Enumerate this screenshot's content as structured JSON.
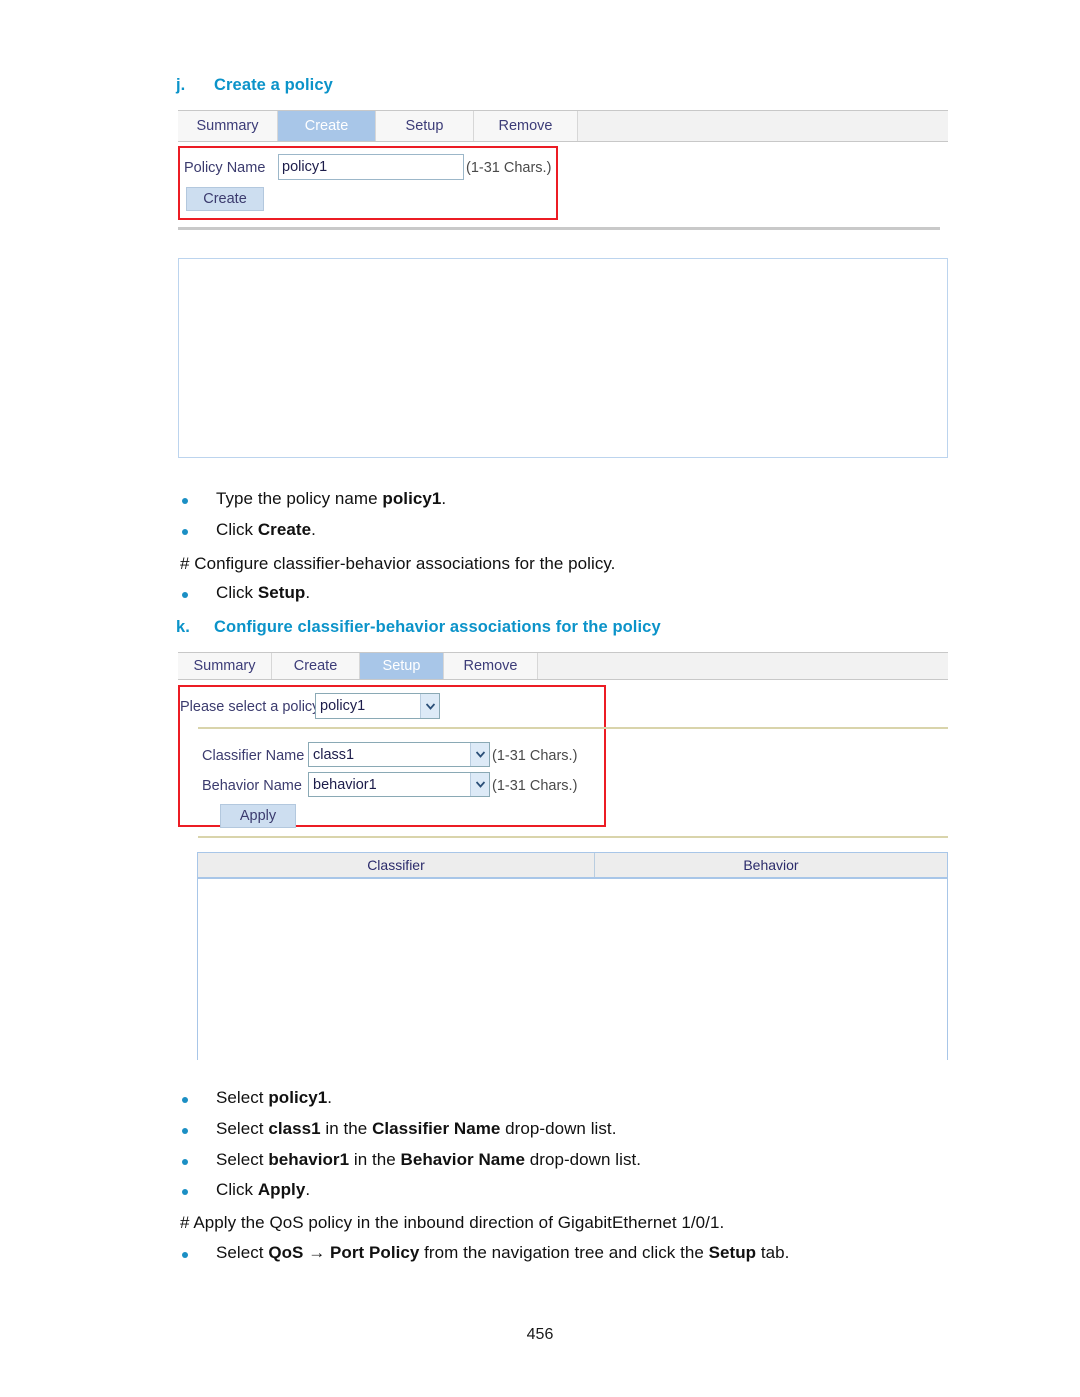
{
  "page": {
    "number": "456"
  },
  "section_j": {
    "letter": "j.",
    "title": "Create a policy",
    "tabs": [
      {
        "label": "Summary",
        "active": false
      },
      {
        "label": "Create",
        "active": true
      },
      {
        "label": "Setup",
        "active": false
      },
      {
        "label": "Remove",
        "active": false
      }
    ],
    "form": {
      "policy_name_label": "Policy Name",
      "policy_name_value": "policy1",
      "policy_name_hint": "(1-31 Chars.)",
      "create_button": "Create"
    }
  },
  "steps_middle": [
    {
      "type": "bullet",
      "text": "Type the policy name ",
      "bold": "policy1",
      "tail": "."
    },
    {
      "type": "bullet",
      "text": "Click ",
      "bold": "Create",
      "tail": "."
    },
    {
      "type": "para",
      "text": "# Configure classifier-behavior associations for the policy."
    },
    {
      "type": "bullet",
      "text": "Click ",
      "bold": "Setup",
      "tail": "."
    }
  ],
  "section_k": {
    "letter": "k.",
    "title": "Configure classifier-behavior associations for the policy",
    "tabs": [
      {
        "label": "Summary",
        "active": false
      },
      {
        "label": "Create",
        "active": false
      },
      {
        "label": "Setup",
        "active": true
      },
      {
        "label": "Remove",
        "active": false
      }
    ],
    "form": {
      "select_policy_label": "Please select a policy",
      "select_policy_value": "policy1",
      "classifier_label": "Classifier Name",
      "classifier_value": "class1",
      "classifier_hint": "(1-31 Chars.)",
      "behavior_label": "Behavior Name",
      "behavior_value": "behavior1",
      "behavior_hint": "(1-31 Chars.)",
      "apply_button": "Apply"
    },
    "table": {
      "columns": [
        "Classifier",
        "Behavior"
      ],
      "rows": []
    }
  },
  "steps_bottom": [
    {
      "type": "bullet",
      "pre": "Select ",
      "bold": "policy1",
      "tail": "."
    },
    {
      "type": "bullet",
      "pre": "Select ",
      "bold": "class1",
      "mid": " in the ",
      "bold2": "Classifier Name",
      "tail": " drop-down list."
    },
    {
      "type": "bullet",
      "pre": "Select ",
      "bold": "behavior1",
      "mid": " in the ",
      "bold2": "Behavior Name",
      "tail": " drop-down list."
    },
    {
      "type": "bullet",
      "pre": "Click ",
      "bold": "Apply",
      "tail": "."
    },
    {
      "type": "para",
      "text": "# Apply the QoS policy in the inbound direction of GigabitEthernet 1/0/1."
    },
    {
      "type": "bullet",
      "pre": "Select ",
      "bold": "QoS → Port Policy",
      "mid": " from the navigation tree and click the ",
      "bold2": "Setup",
      "tail": " tab."
    }
  ],
  "colors": {
    "heading": "#0b93c9",
    "annotation_red": "#ec1c24",
    "tab_active": "#a8c6e8",
    "bullet": "#1b8fc4"
  },
  "icons": {
    "dropdown_arrow": "chevron-down-icon"
  }
}
